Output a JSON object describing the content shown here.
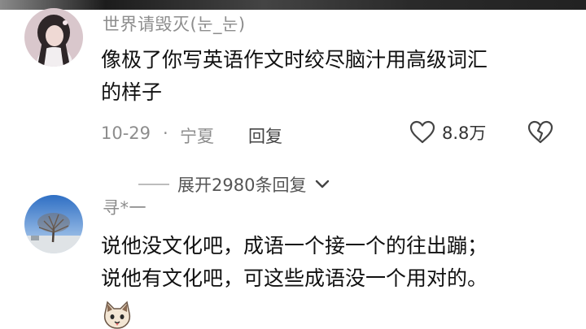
{
  "comment1": {
    "username": "世界请毁灭(눈_눈)",
    "line1": "像极了你写英语作文时绞尽脑汁用高级词汇",
    "line2": "的样子",
    "date": "10-29",
    "separator": "·",
    "location": "宁夏",
    "reply_label": "回复",
    "like_count": "8.8万"
  },
  "expand": {
    "label": "展开2980条回复"
  },
  "comment2": {
    "username": "寻*一",
    "line1": "说他没文化吧，成语一个接一个的往出蹦；",
    "line2": "说他有文化吧，可这些成语没一个用对的。"
  },
  "icons": {
    "like": "heart-outline-icon",
    "dislike": "broken-heart-icon",
    "expand": "chevron-down-icon",
    "sticker": "cat-face-sticker"
  }
}
